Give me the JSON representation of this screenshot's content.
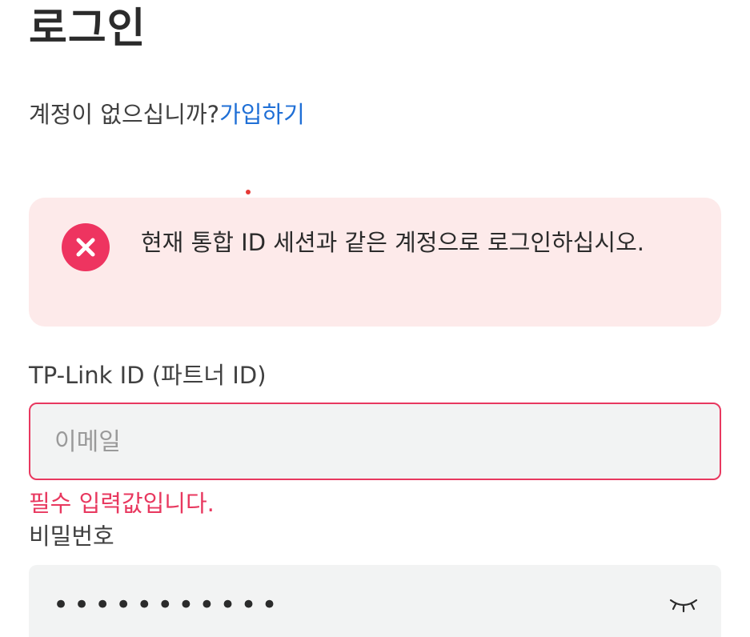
{
  "page": {
    "title": "로그인"
  },
  "signup": {
    "prompt": "계정이 없으십니까?",
    "link_label": "가입하기"
  },
  "alert": {
    "icon": "error-circle-icon",
    "message": "현재 통합 ID 세션과 같은 계정으로 로그인하십시오."
  },
  "email_field": {
    "label": "TP-Link ID (파트너 ID)",
    "placeholder": "이메일",
    "value": "",
    "error": "필수 입력값입니다."
  },
  "password_field": {
    "label": "비밀번호",
    "masked_value": "•••••••••••",
    "toggle_icon": "eye-closed-icon"
  },
  "colors": {
    "accent_link": "#1f6fd6",
    "error": "#e8385f",
    "alert_background": "#fdeaea",
    "input_background": "#f2f3f3"
  }
}
